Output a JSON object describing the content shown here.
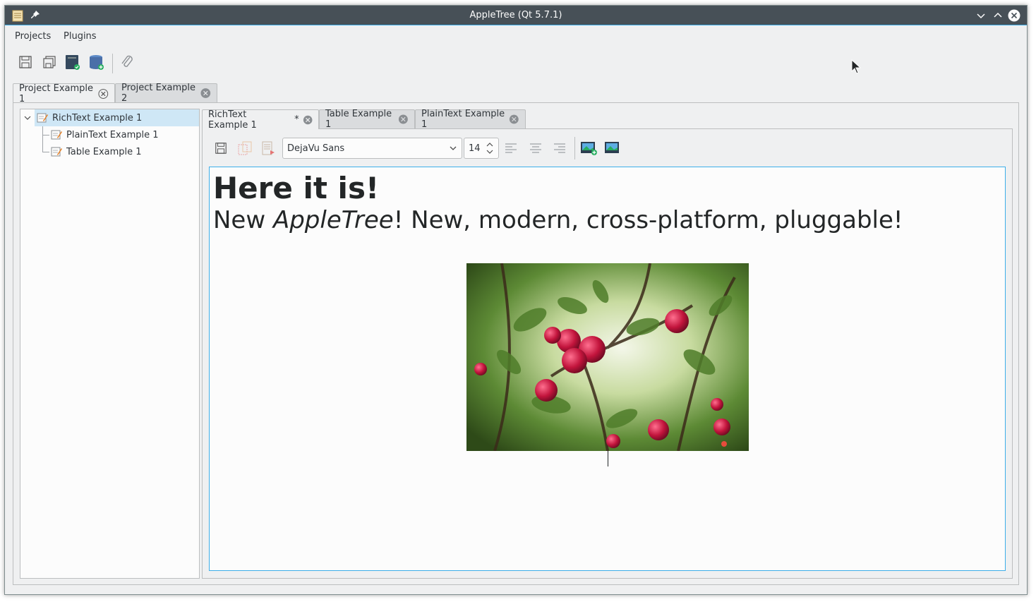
{
  "window": {
    "title": "AppleTree (Qt 5.7.1)"
  },
  "menu": {
    "items": [
      "Projects",
      "Plugins"
    ]
  },
  "toolbar": {
    "buttons": [
      "save-icon",
      "save-all-icon",
      "database-save-icon",
      "database-add-icon",
      "attach-icon"
    ]
  },
  "project_tabs": [
    {
      "label": "Project Example 1",
      "active": true
    },
    {
      "label": "Project Example 2",
      "active": false
    }
  ],
  "tree": {
    "root": "RichText Example 1",
    "children": [
      "PlainText Example 1",
      "Table Example 1"
    ]
  },
  "doc_tabs": [
    {
      "label": "RichText Example 1",
      "modified": "*",
      "active": true
    },
    {
      "label": "Table Example 1",
      "active": false
    },
    {
      "label": "PlainText Example 1",
      "active": false
    }
  ],
  "editor_toolbar": {
    "font": "DejaVu Sans",
    "size": "14"
  },
  "document": {
    "heading": "Here it is!",
    "line_prefix": "New ",
    "line_italic": "AppleTree",
    "line_suffix": "! New, modern, cross-platform,  pluggable!"
  },
  "colors": {
    "accent": "#3daee9",
    "titlebar": "#475057",
    "selection": "#cfe7f6"
  }
}
